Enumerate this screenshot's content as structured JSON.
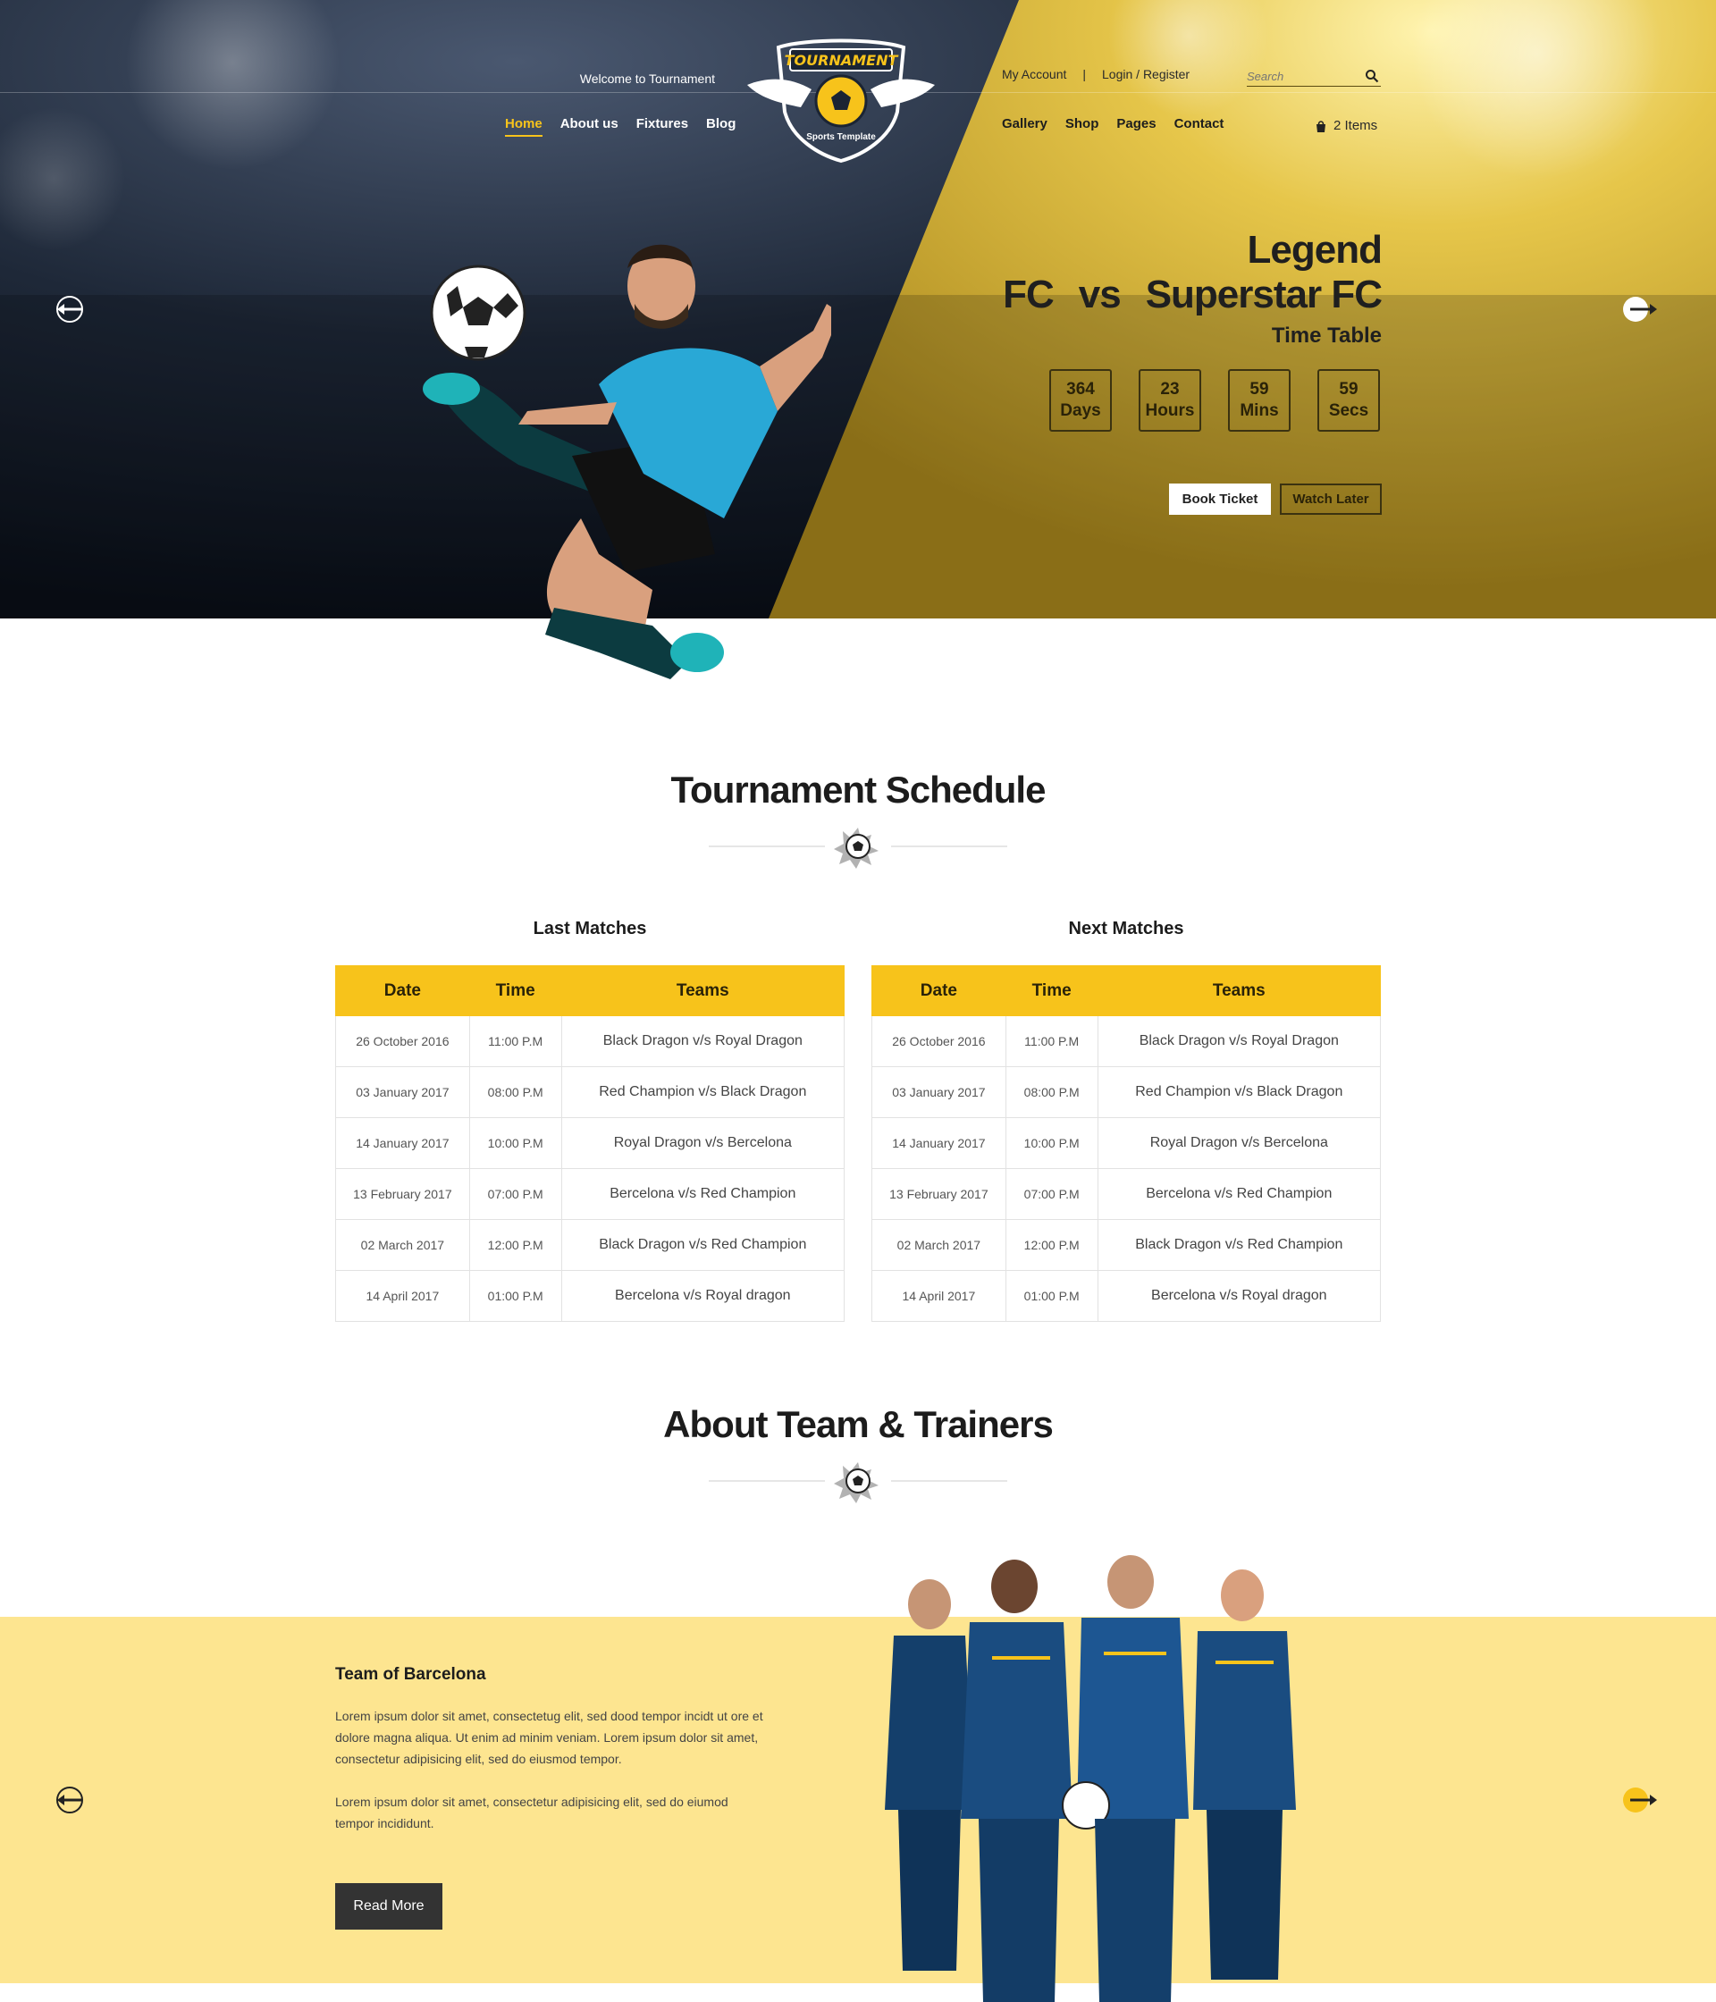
{
  "header": {
    "welcome": "Welcome to Tournament",
    "nav_left": [
      "Home",
      "About us",
      "Fixtures",
      "Blog"
    ],
    "nav_right": [
      "Gallery",
      "Shop",
      "Pages",
      "Contact"
    ],
    "my_account": "My Account",
    "separator": "|",
    "login": "Login / Register",
    "search_placeholder": "Search",
    "cart": "2 Items",
    "logo_title": "TOURNAMENT",
    "logo_subtitle": "Sports Template"
  },
  "hero": {
    "team_a": "Legend FC",
    "vs": "vs",
    "team_b": "Superstar FC",
    "time_table": "Time Table",
    "countdown": [
      {
        "value": "364",
        "unit": "Days"
      },
      {
        "value": "23",
        "unit": "Hours"
      },
      {
        "value": "59",
        "unit": "Mins"
      },
      {
        "value": "59",
        "unit": "Secs"
      }
    ],
    "book_ticket": "Book Ticket",
    "watch_later": "Watch Later"
  },
  "schedule": {
    "title": "Tournament Schedule",
    "headers": [
      "Date",
      "Time",
      "Teams"
    ],
    "last_caption": "Last Matches",
    "next_caption": "Next Matches",
    "last_matches": [
      [
        "26 October 2016",
        "11:00 P.M",
        "Black Dragon v/s Royal Dragon"
      ],
      [
        "03 January 2017",
        "08:00 P.M",
        "Red Champion v/s Black Dragon"
      ],
      [
        "14 January 2017",
        "10:00 P.M",
        "Royal Dragon v/s Bercelona"
      ],
      [
        "13 February 2017",
        "07:00 P.M",
        "Bercelona v/s Red Champion"
      ],
      [
        "02 March 2017",
        "12:00 P.M",
        "Black Dragon v/s Red Champion"
      ],
      [
        "14 April 2017",
        "01:00 P.M",
        "Bercelona v/s Royal dragon"
      ]
    ],
    "next_matches": [
      [
        "26 October 2016",
        "11:00 P.M",
        "Black Dragon v/s Royal Dragon"
      ],
      [
        "03 January 2017",
        "08:00 P.M",
        "Red Champion v/s Black Dragon"
      ],
      [
        "14 January 2017",
        "10:00 P.M",
        "Royal Dragon v/s Bercelona"
      ],
      [
        "13 February 2017",
        "07:00 P.M",
        "Bercelona v/s Red Champion"
      ],
      [
        "02 March 2017",
        "12:00 P.M",
        "Black Dragon v/s Red Champion"
      ],
      [
        "14 April 2017",
        "01:00 P.M",
        "Bercelona v/s Royal dragon"
      ]
    ]
  },
  "team": {
    "section_title": "About Team & Trainers",
    "name": "Team of Barcelona",
    "paragraph1": "Lorem ipsum dolor sit amet, consectetug elit, sed dood tempor incidt ut ore et dolore magna aliqua. Ut enim ad minim veniam. Lorem ipsum dolor sit amet, consectetur adipisicing elit, sed do eiusmod tempor.",
    "paragraph2": "Lorem ipsum dolor sit amet, consectetur adipisicing elit, sed do eiumod tempor incididunt.",
    "read_more": "Read More"
  },
  "colors": {
    "accent": "#f7c31b",
    "hero_dark": "#1b2433",
    "hero_gold": "#c9a62a",
    "team_band": "#fde590",
    "button_dark": "#333333"
  },
  "icons": [
    "arrow-left-icon",
    "arrow-right-icon",
    "search-icon",
    "cart-icon",
    "soccer-ball-icon"
  ]
}
